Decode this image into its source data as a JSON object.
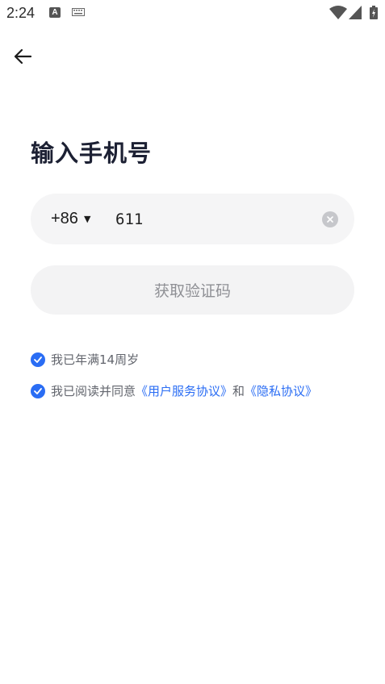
{
  "status_bar": {
    "time": "2:24",
    "notification_a": "A"
  },
  "page": {
    "title": "输入手机号"
  },
  "phone": {
    "country_code": "+86",
    "number": "611"
  },
  "actions": {
    "get_code_label": "获取验证码"
  },
  "agreements": {
    "age_text": "我已年满14周岁",
    "terms_prefix": "我已阅读并同意",
    "user_agreement_link": "《用户服务协议》",
    "and_text": "和",
    "privacy_link": "《隐私协议》"
  },
  "colors": {
    "accent": "#2a6df4",
    "button_bg": "#f3f3f4",
    "input_bg": "#f5f5f6",
    "title": "#1c2033"
  }
}
